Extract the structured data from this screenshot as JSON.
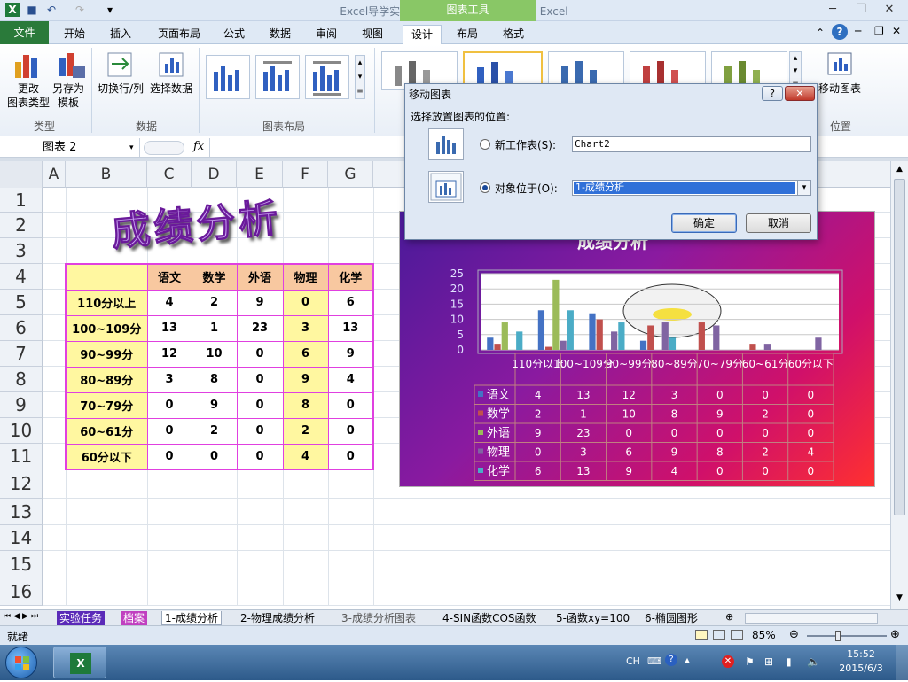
{
  "window": {
    "title": "Excel导学实验12-图表应用1 - Microsoft Excel",
    "context_tools": "图表工具"
  },
  "tabs": [
    "文件",
    "开始",
    "插入",
    "页面布局",
    "公式",
    "数据",
    "审阅",
    "视图",
    "设计",
    "布局",
    "格式"
  ],
  "ribbon": {
    "change_type": [
      "更改",
      "图表类型"
    ],
    "save_template": [
      "另存为",
      "模板"
    ],
    "switch_rowcol": "切换行/列",
    "select_data": "选择数据",
    "move_chart": "移动图表",
    "groups": {
      "type": "类型",
      "data": "数据",
      "layout": "图表布局",
      "location": "位置"
    }
  },
  "namebox": "图表 2",
  "fx": "fx",
  "columns": [
    "A",
    "B",
    "C",
    "D",
    "E",
    "F",
    "G"
  ],
  "rows": [
    "1",
    "2",
    "3",
    "4",
    "5",
    "6",
    "7",
    "8",
    "9",
    "10",
    "11",
    "12",
    "13",
    "14",
    "15",
    "16"
  ],
  "wordart": "成绩分析",
  "table": {
    "headers": [
      "语文",
      "数学",
      "外语",
      "物理",
      "化学"
    ],
    "rows": [
      {
        "label": "110分以上",
        "vals": [
          "4",
          "2",
          "9",
          "0",
          "6"
        ]
      },
      {
        "label": "100~109分",
        "vals": [
          "13",
          "1",
          "23",
          "3",
          "13"
        ]
      },
      {
        "label": "90~99分",
        "vals": [
          "12",
          "10",
          "0",
          "6",
          "9"
        ]
      },
      {
        "label": "80~89分",
        "vals": [
          "3",
          "8",
          "0",
          "9",
          "4"
        ]
      },
      {
        "label": "70~79分",
        "vals": [
          "0",
          "9",
          "0",
          "8",
          "0"
        ]
      },
      {
        "label": "60~61分",
        "vals": [
          "0",
          "2",
          "0",
          "2",
          "0"
        ]
      },
      {
        "label": "60分以下",
        "vals": [
          "0",
          "0",
          "0",
          "4",
          "0"
        ]
      }
    ]
  },
  "chart": {
    "title": "成绩分析",
    "yticks": [
      "25",
      "20",
      "15",
      "10",
      "5",
      "0"
    ],
    "categories": [
      "110分以上",
      "100~109分",
      "90~99分",
      "80~89分",
      "70~79分",
      "60~61分",
      "60分以下"
    ],
    "series": [
      {
        "name": "语文",
        "color": "#4472c4",
        "values": [
          4,
          13,
          12,
          3,
          0,
          0,
          0
        ]
      },
      {
        "name": "数学",
        "color": "#c0504d",
        "values": [
          2,
          1,
          10,
          8,
          9,
          2,
          0
        ]
      },
      {
        "name": "外语",
        "color": "#9bbb59",
        "values": [
          9,
          23,
          0,
          0,
          0,
          0,
          0
        ]
      },
      {
        "name": "物理",
        "color": "#8064a2",
        "values": [
          0,
          3,
          6,
          9,
          8,
          2,
          4
        ]
      },
      {
        "name": "化学",
        "color": "#4bacc6",
        "values": [
          6,
          13,
          9,
          4,
          0,
          0,
          0
        ]
      }
    ]
  },
  "dialog": {
    "title": "移动图表",
    "prompt": "选择放置图表的位置:",
    "opt_new": "新工作表(S):",
    "opt_new_value": "Chart2",
    "opt_obj": "对象位于(O):",
    "opt_obj_value": "1-成绩分析",
    "ok": "确定",
    "cancel": "取消"
  },
  "sheet_tabs": [
    "实验任务",
    "档案",
    "1-成绩分析",
    "2-物理成绩分析",
    "3-成绩分析图表",
    "4-SIN函数COS函数",
    "5-函数xy=100",
    "6-椭圆图形"
  ],
  "status": {
    "ready": "就绪",
    "zoom": "85%"
  },
  "taskbar": {
    "lang": "CH",
    "time": "15:52",
    "date": "2015/6/3"
  }
}
